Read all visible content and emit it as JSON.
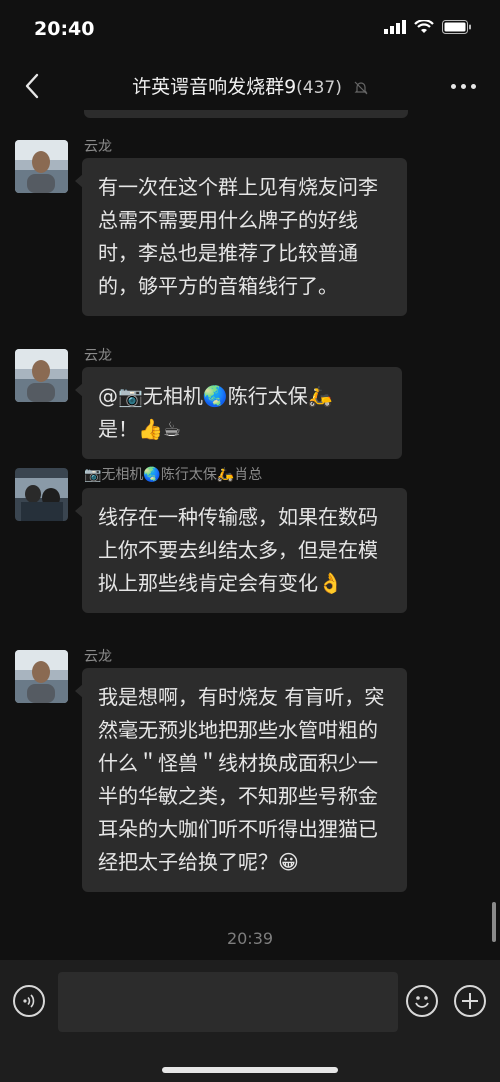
{
  "status_bar": {
    "time": "20:40"
  },
  "header": {
    "title": "许英谔音响发烧群9",
    "count": "(437)"
  },
  "messages": [
    {
      "sender": "云龙",
      "text": "有一次在这个群上见有烧友问李总需不需要用什么牌子的好线时，李总也是推荐了比较普通的，够平方的音箱线行了。"
    },
    {
      "sender": "云龙",
      "text_before": "@📷无相机🌏陈行太保🛵",
      "text_after": "是！👍☕"
    },
    {
      "sender": "📷无相机🌏陈行太保🛵肖总",
      "text": "线存在一种传输感，如果在数码上你不要去纠结太多，但是在模拟上那些线肯定会有变化👌"
    },
    {
      "sender": "云龙",
      "text": "我是想啊，有时烧友 有肓听，突然毫无预兆地把那些水管咁粗的什么＂怪兽＂线材换成面积少一半的华敏之类，不知那些号称金耳朵的大咖们听不听得出狸猫已经把太子给换了呢？😀"
    }
  ],
  "timestamp": "20:39",
  "icons": {
    "back": "chevron-left-icon",
    "mute": "bell-off-icon",
    "more": "more-horizontal-icon",
    "voice": "voice-icon",
    "emoji": "emoji-icon",
    "add": "plus-circle-icon"
  }
}
